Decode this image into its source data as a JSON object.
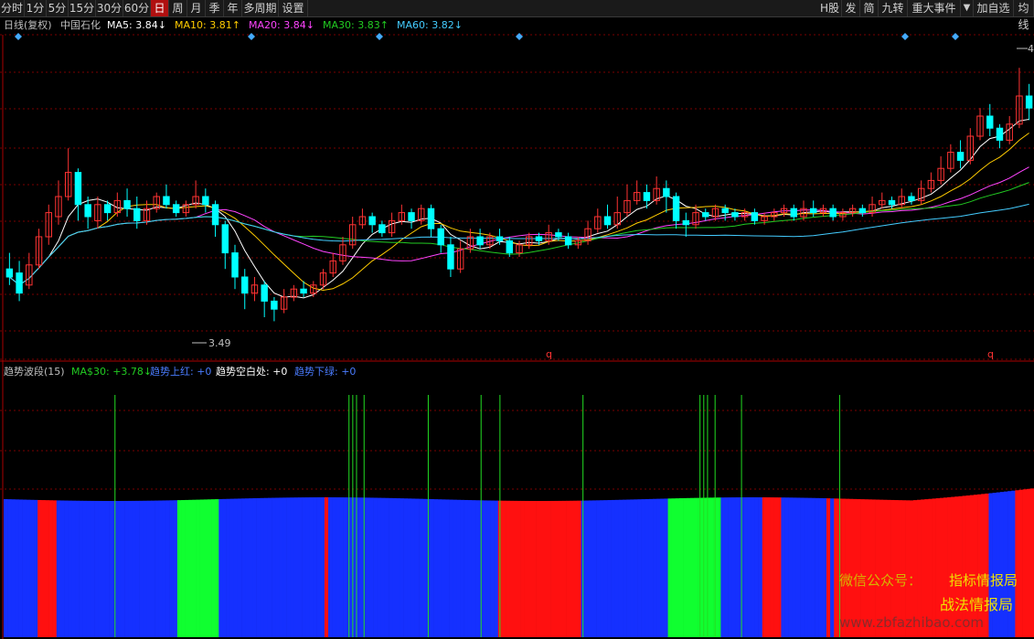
{
  "toolbar": {
    "left": [
      "分时",
      "1分",
      "5分",
      "15分",
      "30分",
      "60分",
      "日",
      "周",
      "月",
      "季",
      "年",
      "多周期",
      "设置"
    ],
    "active": "日",
    "right": [
      "H股",
      "发",
      "简",
      "九转",
      "重大事件",
      "▼",
      "加自选",
      "均线"
    ]
  },
  "main_legend": {
    "title": "日线(复权)",
    "stock": "中国石化",
    "ma": [
      {
        "label": "MA5: 3.84",
        "arrow": "↓",
        "color": "#ffffff"
      },
      {
        "label": "MA10: 3.81",
        "arrow": "↑",
        "color": "#ffcc00"
      },
      {
        "label": "MA20: 3.84",
        "arrow": "↓",
        "color": "#ff44ff"
      },
      {
        "label": "MA30: 3.83",
        "arrow": "↑",
        "color": "#22cc22"
      },
      {
        "label": "MA60: 3.82",
        "arrow": "↓",
        "color": "#44ccff"
      }
    ]
  },
  "sub_legend": {
    "items": [
      {
        "label": "趋势波段(15)",
        "color": "#c0c0c0"
      },
      {
        "label": "MA$30: +3.78↓",
        "color": "#22cc22"
      },
      {
        "label": "趋势上红: +0",
        "color": "#4a7cff"
      },
      {
        "label": "趋势空白处: +0",
        "color": "#ffffff"
      },
      {
        "label": "趋势下绿: +0",
        "color": "#4a7cff"
      }
    ]
  },
  "annotations": {
    "low_price": "3.49",
    "high_price_partial": "4",
    "q_marks": [
      "q",
      "q"
    ]
  },
  "watermark": {
    "line1": "微信公众号：",
    "line1b": "指标情报局",
    "line2": "战法情报局",
    "line3": "www.zbfazhibao.com"
  },
  "colors": {
    "up": "#ff3333",
    "down": "#00ffff",
    "grid": "#7a0000",
    "diamond": "#44aaff",
    "hist_red": "#ff1010",
    "hist_blue": "#1530ff",
    "hist_green": "#10ff30",
    "spike": "#22dd22"
  },
  "chart_data": {
    "type": "candlestick",
    "y_range": [
      3.4,
      4.2
    ],
    "candles": [
      [
        3.62,
        3.6,
        3.66,
        3.58
      ],
      [
        3.61,
        3.56,
        3.64,
        3.54
      ],
      [
        3.58,
        3.63,
        3.66,
        3.57
      ],
      [
        3.63,
        3.7,
        3.72,
        3.62
      ],
      [
        3.7,
        3.76,
        3.78,
        3.68
      ],
      [
        3.75,
        3.8,
        3.84,
        3.73
      ],
      [
        3.8,
        3.86,
        3.92,
        3.79
      ],
      [
        3.86,
        3.78,
        3.87,
        3.74
      ],
      [
        3.78,
        3.75,
        3.8,
        3.72
      ],
      [
        3.74,
        3.78,
        3.8,
        3.72
      ],
      [
        3.78,
        3.76,
        3.79,
        3.74
      ],
      [
        3.76,
        3.79,
        3.81,
        3.75
      ],
      [
        3.79,
        3.77,
        3.82,
        3.75
      ],
      [
        3.77,
        3.74,
        3.8,
        3.72
      ],
      [
        3.74,
        3.77,
        3.79,
        3.73
      ],
      [
        3.77,
        3.8,
        3.81,
        3.76
      ],
      [
        3.8,
        3.78,
        3.83,
        3.77
      ],
      [
        3.78,
        3.76,
        3.79,
        3.75
      ],
      [
        3.76,
        3.78,
        3.79,
        3.75
      ],
      [
        3.78,
        3.8,
        3.84,
        3.77
      ],
      [
        3.8,
        3.78,
        3.82,
        3.76
      ],
      [
        3.78,
        3.73,
        3.79,
        3.7
      ],
      [
        3.73,
        3.66,
        3.74,
        3.62
      ],
      [
        3.66,
        3.6,
        3.68,
        3.57
      ],
      [
        3.6,
        3.56,
        3.62,
        3.52
      ],
      [
        3.56,
        3.58,
        3.6,
        3.54
      ],
      [
        3.58,
        3.54,
        3.59,
        3.5
      ],
      [
        3.54,
        3.52,
        3.55,
        3.49
      ],
      [
        3.52,
        3.55,
        3.57,
        3.51
      ],
      [
        3.55,
        3.57,
        3.58,
        3.54
      ],
      [
        3.57,
        3.56,
        3.59,
        3.55
      ],
      [
        3.56,
        3.58,
        3.59,
        3.55
      ],
      [
        3.58,
        3.61,
        3.62,
        3.57
      ],
      [
        3.61,
        3.64,
        3.66,
        3.6
      ],
      [
        3.64,
        3.68,
        3.7,
        3.63
      ],
      [
        3.68,
        3.73,
        3.75,
        3.67
      ],
      [
        3.73,
        3.75,
        3.77,
        3.72
      ],
      [
        3.75,
        3.73,
        3.76,
        3.71
      ],
      [
        3.73,
        3.71,
        3.74,
        3.7
      ],
      [
        3.71,
        3.74,
        3.76,
        3.7
      ],
      [
        3.74,
        3.76,
        3.78,
        3.73
      ],
      [
        3.76,
        3.74,
        3.77,
        3.72
      ],
      [
        3.74,
        3.77,
        3.78,
        3.73
      ],
      [
        3.77,
        3.72,
        3.78,
        3.7
      ],
      [
        3.72,
        3.68,
        3.73,
        3.66
      ],
      [
        3.68,
        3.62,
        3.7,
        3.6
      ],
      [
        3.62,
        3.67,
        3.69,
        3.61
      ],
      [
        3.67,
        3.7,
        3.72,
        3.66
      ],
      [
        3.7,
        3.68,
        3.72,
        3.67
      ],
      [
        3.68,
        3.7,
        3.71,
        3.67
      ],
      [
        3.7,
        3.69,
        3.72,
        3.68
      ],
      [
        3.69,
        3.66,
        3.7,
        3.65
      ],
      [
        3.66,
        3.68,
        3.69,
        3.65
      ],
      [
        3.68,
        3.7,
        3.71,
        3.67
      ],
      [
        3.7,
        3.69,
        3.71,
        3.68
      ],
      [
        3.69,
        3.71,
        3.73,
        3.68
      ],
      [
        3.71,
        3.7,
        3.72,
        3.69
      ],
      [
        3.7,
        3.68,
        3.71,
        3.67
      ],
      [
        3.68,
        3.69,
        3.7,
        3.67
      ],
      [
        3.69,
        3.72,
        3.74,
        3.68
      ],
      [
        3.72,
        3.75,
        3.77,
        3.71
      ],
      [
        3.75,
        3.73,
        3.78,
        3.72
      ],
      [
        3.73,
        3.76,
        3.8,
        3.72
      ],
      [
        3.76,
        3.79,
        3.83,
        3.75
      ],
      [
        3.79,
        3.81,
        3.84,
        3.78
      ],
      [
        3.81,
        3.79,
        3.83,
        3.77
      ],
      [
        3.79,
        3.82,
        3.85,
        3.78
      ],
      [
        3.82,
        3.8,
        3.84,
        3.76
      ],
      [
        3.8,
        3.74,
        3.81,
        3.72
      ],
      [
        3.74,
        3.73,
        3.76,
        3.7
      ],
      [
        3.73,
        3.76,
        3.78,
        3.72
      ],
      [
        3.76,
        3.75,
        3.77,
        3.74
      ],
      [
        3.75,
        3.77,
        3.78,
        3.74
      ],
      [
        3.77,
        3.76,
        3.78,
        3.74
      ],
      [
        3.76,
        3.75,
        3.77,
        3.74
      ],
      [
        3.75,
        3.76,
        3.77,
        3.74
      ],
      [
        3.76,
        3.74,
        3.77,
        3.73
      ],
      [
        3.74,
        3.75,
        3.76,
        3.73
      ],
      [
        3.75,
        3.76,
        3.77,
        3.74
      ],
      [
        3.76,
        3.77,
        3.78,
        3.75
      ],
      [
        3.77,
        3.75,
        3.78,
        3.74
      ],
      [
        3.75,
        3.77,
        3.79,
        3.74
      ],
      [
        3.77,
        3.76,
        3.79,
        3.75
      ],
      [
        3.76,
        3.77,
        3.78,
        3.75
      ],
      [
        3.77,
        3.75,
        3.78,
        3.74
      ],
      [
        3.75,
        3.76,
        3.77,
        3.74
      ],
      [
        3.76,
        3.77,
        3.78,
        3.75
      ],
      [
        3.77,
        3.76,
        3.78,
        3.75
      ],
      [
        3.76,
        3.78,
        3.8,
        3.75
      ],
      [
        3.78,
        3.79,
        3.81,
        3.77
      ],
      [
        3.79,
        3.78,
        3.8,
        3.77
      ],
      [
        3.78,
        3.8,
        3.82,
        3.77
      ],
      [
        3.8,
        3.79,
        3.81,
        3.78
      ],
      [
        3.79,
        3.82,
        3.84,
        3.78
      ],
      [
        3.82,
        3.84,
        3.86,
        3.81
      ],
      [
        3.84,
        3.87,
        3.9,
        3.83
      ],
      [
        3.87,
        3.91,
        3.93,
        3.86
      ],
      [
        3.91,
        3.89,
        3.94,
        3.87
      ],
      [
        3.89,
        3.95,
        3.97,
        3.88
      ],
      [
        3.95,
        4.0,
        4.02,
        3.94
      ],
      [
        4.0,
        3.97,
        4.03,
        3.95
      ],
      [
        3.97,
        3.94,
        3.98,
        3.92
      ],
      [
        3.94,
        3.98,
        4.0,
        3.93
      ],
      [
        3.98,
        4.05,
        4.12,
        3.97
      ],
      [
        4.05,
        4.02,
        4.08,
        3.99
      ]
    ],
    "histogram": {
      "colors": [
        "b",
        "b",
        "b",
        "b",
        "b",
        "b",
        "b",
        "b",
        "b",
        "r",
        "r",
        "r",
        "r",
        "r",
        "b",
        "b",
        "b",
        "b",
        "b",
        "b",
        "b",
        "b",
        "b",
        "b",
        "b",
        "b",
        "b",
        "b",
        "b",
        "b",
        "b",
        "b",
        "b",
        "b",
        "b",
        "b",
        "b",
        "b",
        "b",
        "b",
        "b",
        "b",
        "b",
        "b",
        "b",
        "b",
        "g",
        "g",
        "g",
        "g",
        "g",
        "g",
        "g",
        "g",
        "g",
        "g",
        "g",
        "b",
        "b",
        "b",
        "b",
        "b",
        "b",
        "b",
        "b",
        "b",
        "b",
        "b",
        "b",
        "b",
        "b",
        "b",
        "b",
        "b",
        "b",
        "b",
        "b",
        "b",
        "b",
        "b",
        "b",
        "b",
        "b",
        "b",
        "b",
        "r",
        "b",
        "b",
        "b",
        "b",
        "b",
        "b",
        "b",
        "b",
        "b",
        "b",
        "b",
        "b",
        "b",
        "b",
        "b",
        "b",
        "b",
        "b",
        "b",
        "b",
        "b",
        "b",
        "b",
        "b",
        "b",
        "b",
        "b",
        "b",
        "b",
        "b",
        "b",
        "b",
        "b",
        "b",
        "b",
        "b",
        "b",
        "b",
        "b",
        "b",
        "b",
        "b",
        "b",
        "b",
        "b",
        "r",
        "r",
        "r",
        "r",
        "r",
        "r",
        "r",
        "r",
        "r",
        "r",
        "r",
        "r",
        "r",
        "r",
        "r",
        "r",
        "r",
        "r",
        "r",
        "r",
        "r",
        "r",
        "b",
        "b",
        "b",
        "b",
        "b",
        "b",
        "b",
        "b",
        "b",
        "b",
        "b",
        "b",
        "b",
        "b",
        "b",
        "b",
        "b",
        "b",
        "b",
        "b",
        "b",
        "b",
        "b",
        "g",
        "g",
        "g",
        "g",
        "g",
        "g",
        "g",
        "g",
        "g",
        "g",
        "g",
        "g",
        "g",
        "g",
        "b",
        "b",
        "b",
        "b",
        "b",
        "b",
        "b",
        "b",
        "b",
        "b",
        "b",
        "r",
        "r",
        "r",
        "r",
        "r",
        "b",
        "b",
        "b",
        "b",
        "b",
        "b",
        "b",
        "b",
        "b",
        "b",
        "b",
        "b",
        "r",
        "b",
        "r",
        "r",
        "r",
        "r",
        "r",
        "r",
        "r",
        "r",
        "r",
        "r",
        "r",
        "r",
        "r",
        "r",
        "r",
        "r",
        "r",
        "r",
        "r",
        "r",
        "r",
        "r",
        "r",
        "r",
        "r",
        "r",
        "r",
        "r",
        "r",
        "r",
        "r",
        "r",
        "r",
        "r",
        "r",
        "r",
        "r",
        "r",
        "r",
        "r",
        "r",
        "b",
        "b",
        "b",
        "b",
        "b",
        "b",
        "b",
        "r",
        "r",
        "r",
        "r",
        "r"
      ],
      "spikes": [
        29,
        91,
        92,
        93,
        95,
        112,
        126,
        131,
        153,
        184,
        185,
        186,
        188,
        195,
        221
      ]
    }
  }
}
